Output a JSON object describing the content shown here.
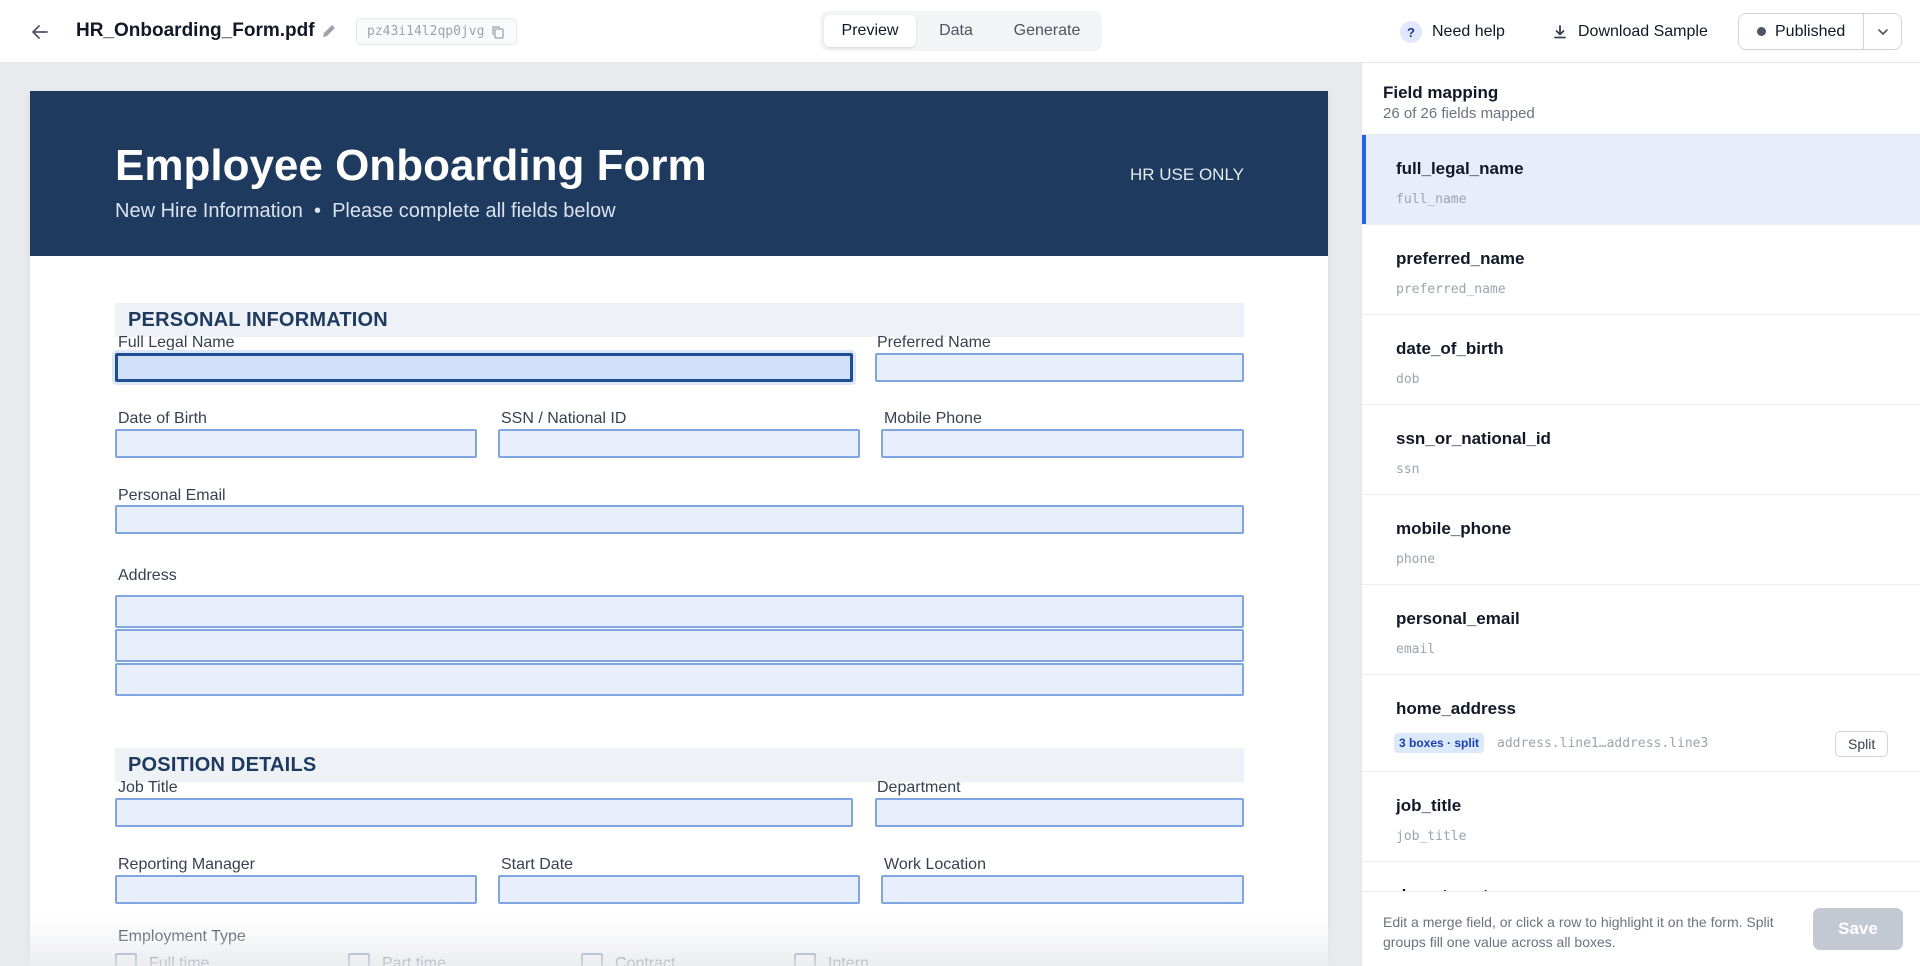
{
  "toolbar": {
    "file_name": "HR_Onboarding_Form.pdf",
    "doc_id": "pz43i14l2qp0jvg",
    "tabs": [
      {
        "label": "Preview",
        "active": true
      },
      {
        "label": "Data",
        "active": false
      },
      {
        "label": "Generate",
        "active": false
      }
    ],
    "help_label": "Need help",
    "help_glyph": "?",
    "download_label": "Download Sample",
    "status_label": "Published",
    "icons": [
      "arrow-left-icon",
      "pencil-icon",
      "copy-icon",
      "question-icon",
      "download-icon",
      "chevron-down-icon"
    ]
  },
  "form": {
    "title": "Employee Onboarding Form",
    "subtitle": "New Hire Information  •  Please complete all fields below",
    "hr_note": "HR USE ONLY",
    "sections": {
      "personal": "PERSONAL INFORMATION",
      "position": "POSITION DETAILS"
    },
    "labels": {
      "full_legal_name": "Full Legal Name",
      "preferred_name": "Preferred Name",
      "date_of_birth": "Date of Birth",
      "ssn": "SSN / National ID",
      "mobile_phone": "Mobile Phone",
      "personal_email": "Personal Email",
      "address": "Address",
      "job_title": "Job Title",
      "department": "Department",
      "reporting_manager": "Reporting Manager",
      "start_date": "Start Date",
      "work_location": "Work Location",
      "employment_type": "Employment Type"
    },
    "employment_options": [
      "Full time",
      "Part time",
      "Contract",
      "Intern"
    ]
  },
  "panel": {
    "title": "Field mapping",
    "subtitle": "26 of 26 fields mapped",
    "rows": [
      {
        "name": "full_legal_name",
        "key": "full_name",
        "selected": true
      },
      {
        "name": "preferred_name",
        "key": "preferred_name"
      },
      {
        "name": "date_of_birth",
        "key": "dob"
      },
      {
        "name": "ssn_or_national_id",
        "key": "ssn"
      },
      {
        "name": "mobile_phone",
        "key": "phone"
      },
      {
        "name": "personal_email",
        "key": "email"
      },
      {
        "name": "home_address",
        "badge": "3 boxes · split",
        "key": "address.line1…address.line3",
        "action": "Split"
      },
      {
        "name": "job_title",
        "key": "job_title"
      },
      {
        "name": "department",
        "key": ""
      }
    ],
    "footer_text": "Edit a merge field, or click a row to highlight it on the form. Split groups fill one value across all boxes.",
    "save_label": "Save"
  },
  "colors": {
    "header_navy": "#1e3a5f",
    "field_fill": "#e8eefb",
    "field_border": "#7fa6e0",
    "selected_accent": "#2563eb"
  }
}
